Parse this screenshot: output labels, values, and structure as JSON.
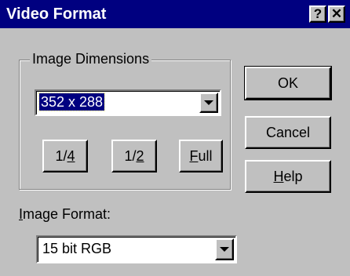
{
  "window": {
    "title": "Video Format",
    "help_button": "?",
    "close_button": "✕"
  },
  "image_dimensions": {
    "group_label": "Image Dimensions",
    "selected_value": "352 x 288",
    "buttons": {
      "quarter": {
        "prefix": "1/",
        "mnemonic": "4",
        "suffix": ""
      },
      "half": {
        "prefix": "1/",
        "mnemonic": "2",
        "suffix": ""
      },
      "full": {
        "prefix": "",
        "mnemonic": "F",
        "suffix": "ull"
      }
    }
  },
  "image_format": {
    "label_mnemonic": "I",
    "label_rest": "mage Format:",
    "selected_value": "15 bit RGB"
  },
  "actions": {
    "ok": "OK",
    "cancel": "Cancel",
    "help_mnemonic": "H",
    "help_rest": "elp"
  },
  "icons": {
    "dropdown": "chevron-down-icon",
    "close": "close-icon",
    "help": "help-icon"
  }
}
